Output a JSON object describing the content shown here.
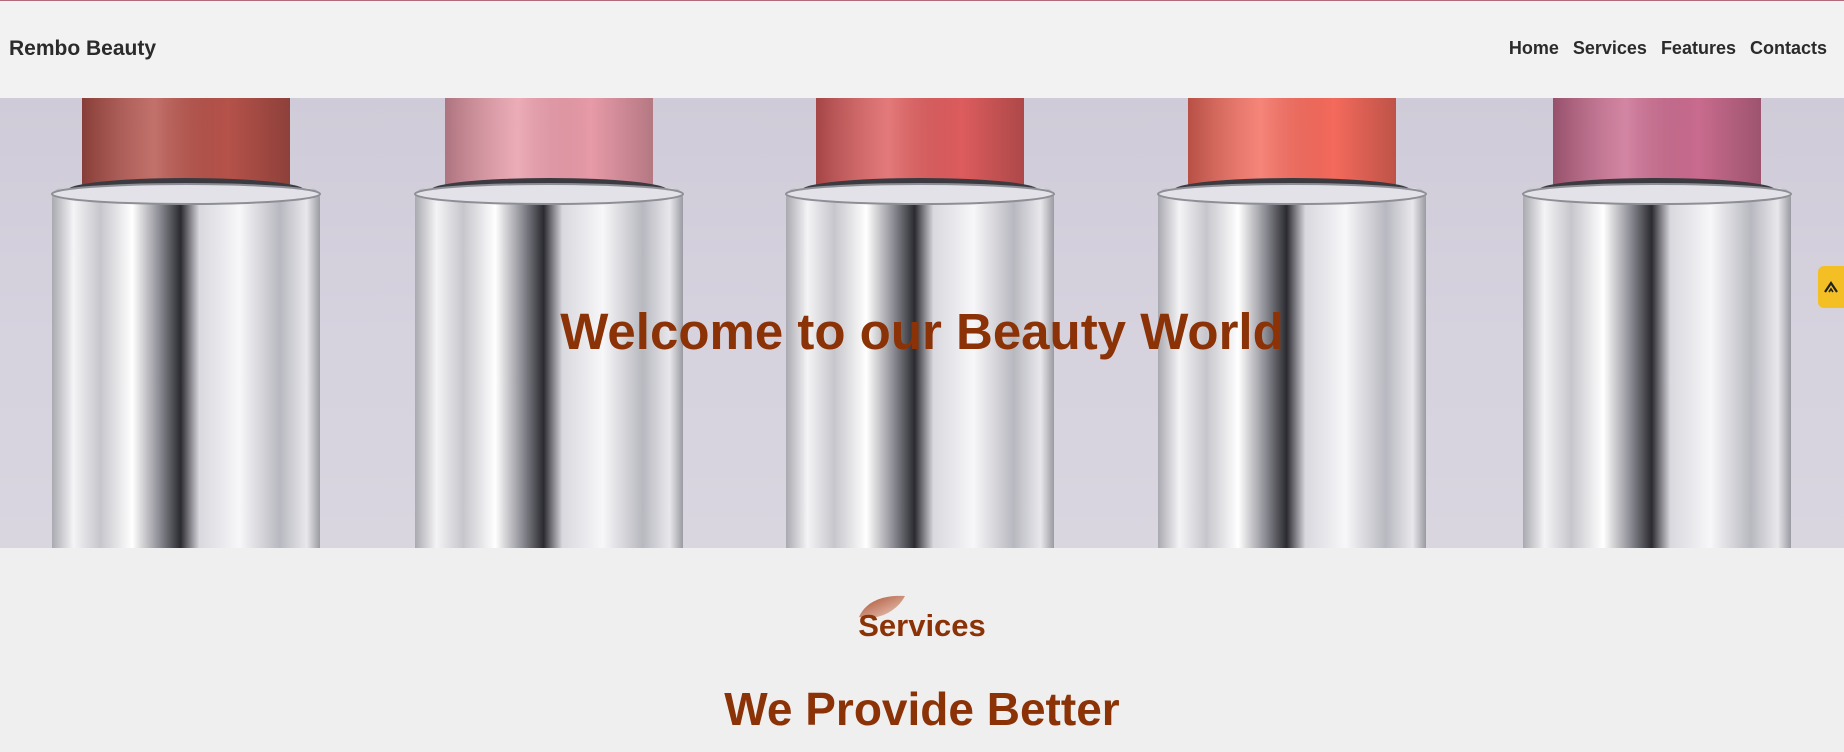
{
  "header": {
    "brand": "Rembo Beauty",
    "nav": [
      {
        "label": "Home"
      },
      {
        "label": "Services"
      },
      {
        "label": "Features"
      },
      {
        "label": "Contacts"
      }
    ]
  },
  "hero": {
    "title": "Welcome to our Beauty World",
    "image_description": "five lipsticks in silver tubes",
    "lipstick_colors": [
      "#b5524a",
      "#e79aa8",
      "#dd5c5d",
      "#f46a5c",
      "#c96b8e"
    ]
  },
  "side_tab": {
    "icon": "chevron-up-icon",
    "color": "#f3bf25"
  },
  "services": {
    "label": "Services",
    "icon": "leaf-icon",
    "heading": "We Provide Better"
  },
  "colors": {
    "accent": "#8b3207",
    "text": "#2b2b2b",
    "background": "#efefef"
  }
}
